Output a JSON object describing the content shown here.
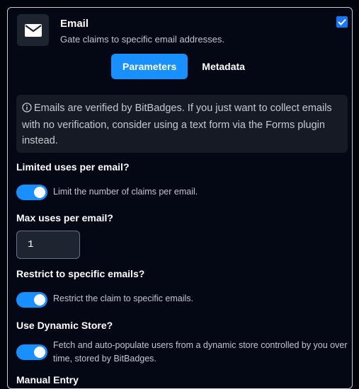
{
  "plugin": {
    "title": "Email",
    "subtitle": "Gate claims to specific email addresses.",
    "icon": "envelope-icon",
    "enabled": true
  },
  "tabs": [
    {
      "label": "Parameters",
      "active": true
    },
    {
      "label": "Metadata",
      "active": false
    }
  ],
  "info": {
    "icon": "info-circle-icon",
    "text": "Emails are verified by BitBadges. If you just want to collect emails with no verification, consider using a text form via the Forms plugin instead."
  },
  "settings": {
    "limited_uses": {
      "label": "Limited uses per email?",
      "toggle_on": true,
      "description": "Limit the number of claims per email."
    },
    "max_uses": {
      "label": "Max uses per email?",
      "value": "1"
    },
    "restrict_emails": {
      "label": "Restrict to specific emails?",
      "toggle_on": true,
      "description": "Restrict the claim to specific emails."
    },
    "dynamic_store": {
      "label": "Use Dynamic Store?",
      "toggle_on": true,
      "description": "Fetch and auto-populate users from a dynamic store controlled by you over time, stored by BitBadges."
    },
    "manual_entry": {
      "label": "Manual Entry"
    }
  },
  "colors": {
    "accent": "#1890ff",
    "background": "#01040c",
    "info_background": "#151a24"
  }
}
